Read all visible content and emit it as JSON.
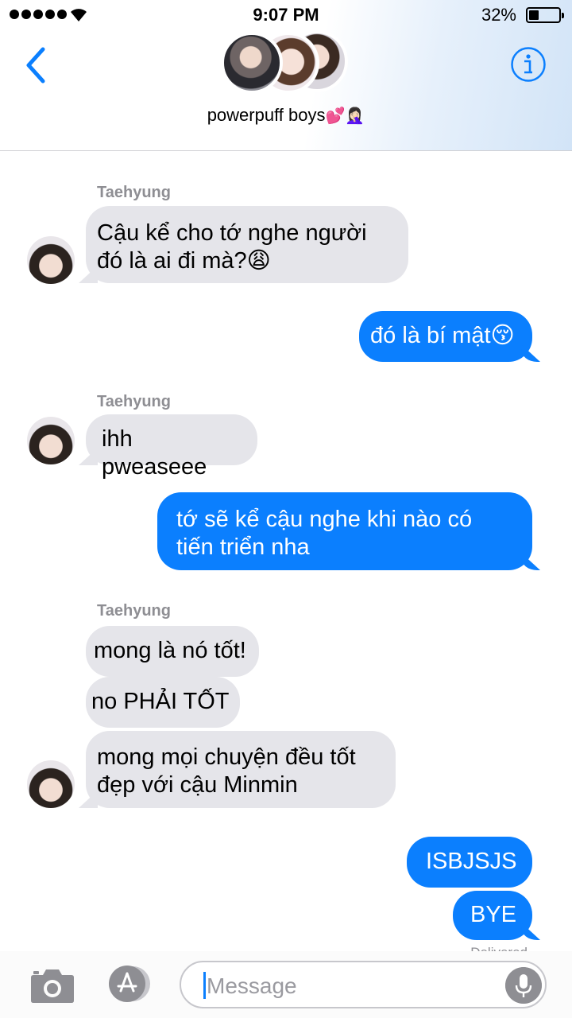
{
  "status": {
    "time": "9:07 PM",
    "battery": "32%"
  },
  "header": {
    "group_name": "powerpuff boys",
    "group_emoji": "💕🤦🏻‍♀️"
  },
  "messages": [
    {
      "sender": "Taehyung",
      "text_line1": "Cậu kể cho tớ nghe người",
      "text_line2": "đó là ai đi mà?😩"
    },
    {
      "text": "đó là bí mật😚"
    },
    {
      "sender": "Taehyung",
      "text": "ihh pweaseee"
    },
    {
      "text_line1": "tớ sẽ kể cậu nghe khi nào có",
      "text_line2": "tiến triển nha"
    },
    {
      "sender": "Taehyung",
      "text": "mong là nó tốt!"
    },
    {
      "text": "no PHẢI TỐT"
    },
    {
      "text_line1": "mong mọi chuyện đều tốt",
      "text_line2": "đẹp với cậu Minmin"
    },
    {
      "text": "ISBJSJS"
    },
    {
      "text": "BYE"
    }
  ],
  "delivered": "Delivered",
  "input": {
    "placeholder": "Message"
  }
}
